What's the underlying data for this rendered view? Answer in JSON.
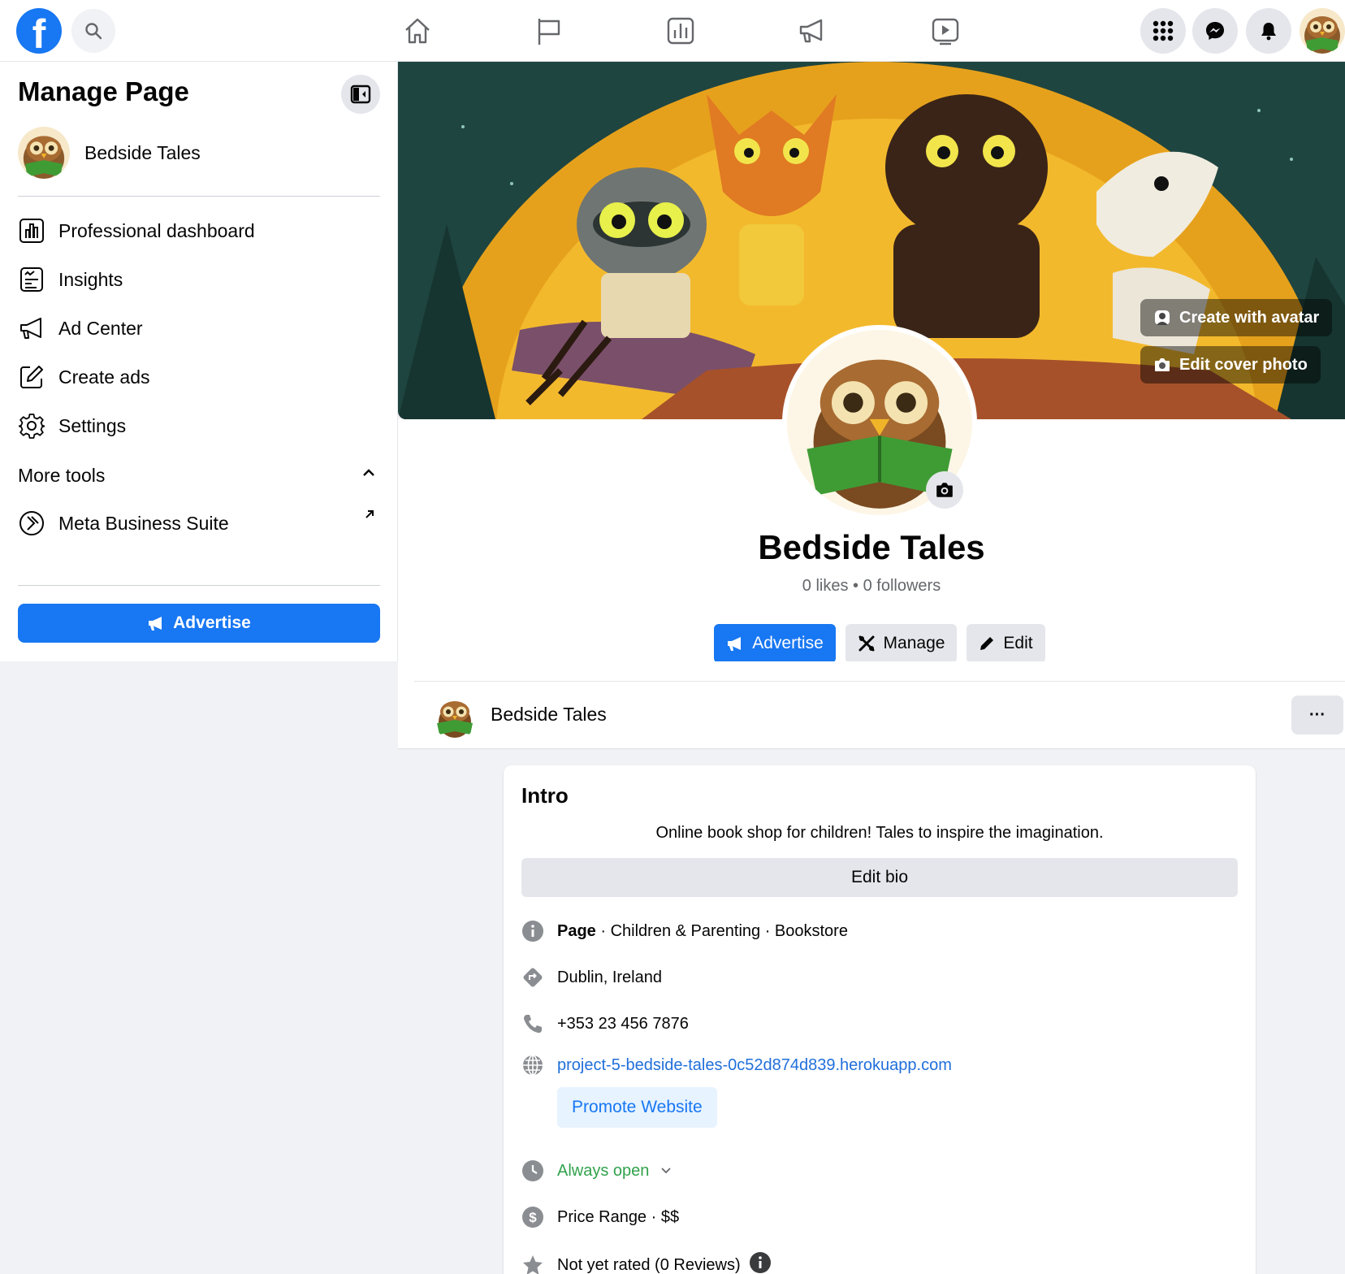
{
  "colors": {
    "accent": "#1877f2",
    "green_open": "#31a24c",
    "muted": "#65676b"
  },
  "topbar": {
    "logo": "f",
    "icons": [
      "search-icon",
      "home-icon",
      "flag-icon",
      "insights-icon",
      "megaphone-icon",
      "video-icon",
      "menu-grid-icon",
      "messenger-icon",
      "bell-icon"
    ]
  },
  "sidebar": {
    "title": "Manage Page",
    "page_name": "Bedside Tales",
    "items": [
      {
        "label": "Professional dashboard",
        "icon": "dashboard-icon"
      },
      {
        "label": "Insights",
        "icon": "insights-icon"
      },
      {
        "label": "Ad Center",
        "icon": "megaphone-icon"
      },
      {
        "label": "Create ads",
        "icon": "edit-icon"
      },
      {
        "label": "Settings",
        "icon": "gear-icon"
      }
    ],
    "more_tools": "More tools",
    "meta_business": "Meta Business Suite",
    "advertise": "Advertise"
  },
  "cover": {
    "create_avatar": "Create with avatar",
    "edit_cover": "Edit cover photo"
  },
  "profile": {
    "name": "Bedside Tales",
    "stats": "0 likes • 0 followers",
    "advertise": "Advertise",
    "manage": "Manage",
    "edit": "Edit"
  },
  "strip": {
    "name": "Bedside Tales",
    "more": "···"
  },
  "intro": {
    "title": "Intro",
    "bio": "Online book shop for children! Tales to inspire the imagination.",
    "edit_bio": "Edit bio",
    "category_bold": "Page",
    "category_rest": " · Children & Parenting · Bookstore",
    "location": "Dublin, Ireland",
    "phone": "+353 23 456 7876",
    "website": "project-5-bedside-tales-0c52d874d839.herokuapp.com",
    "promote": "Promote Website",
    "hours": "Always open",
    "price": "Price Range · $$",
    "rating": "Not yet rated (0 Reviews)"
  }
}
